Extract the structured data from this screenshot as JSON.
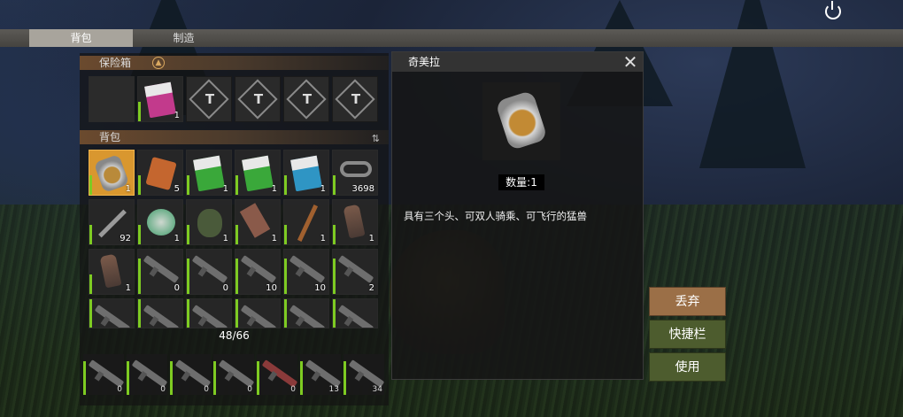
{
  "tabs": {
    "backpack": "背包",
    "craft": "制造"
  },
  "safe_box": {
    "title": "保险箱",
    "slots": [
      {
        "kind": "empty"
      },
      {
        "kind": "item",
        "icon": "pink-recipe-book-icon",
        "color": "#c23a8c",
        "count": "1"
      },
      {
        "kind": "locked",
        "icon": "lock-icon",
        "glyph": "T"
      },
      {
        "kind": "locked",
        "icon": "lock-icon",
        "glyph": "T"
      },
      {
        "kind": "locked",
        "icon": "lock-icon",
        "glyph": "T"
      },
      {
        "kind": "locked",
        "icon": "lock-icon",
        "glyph": "T"
      }
    ]
  },
  "backpack": {
    "title": "背包",
    "sort_icon": "sort-icon",
    "capacity": "48/66",
    "slots": [
      {
        "icon": "dog-tag-icon",
        "count": "1",
        "selected": true
      },
      {
        "icon": "orange-crate-icon",
        "count": "5"
      },
      {
        "icon": "green-recipe-book-icon",
        "count": "1",
        "color": "#3aa83a"
      },
      {
        "icon": "green-recipe-book-icon",
        "count": "1",
        "color": "#3aa83a"
      },
      {
        "icon": "blue-recipe-book-icon",
        "count": "1",
        "color": "#2f95c4"
      },
      {
        "icon": "gun-parts-icon",
        "count": "3698"
      },
      {
        "icon": "syringe-icon",
        "count": "92"
      },
      {
        "icon": "canned-food-icon",
        "count": "1"
      },
      {
        "icon": "grenade-icon",
        "count": "1"
      },
      {
        "icon": "cleaver-icon",
        "count": "1"
      },
      {
        "icon": "wooden-staff-icon",
        "count": "1"
      },
      {
        "icon": "leather-glove-icon",
        "count": "1"
      },
      {
        "icon": "leather-glove-icon",
        "count": "1"
      },
      {
        "icon": "rifle-icon",
        "count": "0"
      },
      {
        "icon": "rifle-icon",
        "count": "0"
      },
      {
        "icon": "rifle-icon",
        "count": "10"
      },
      {
        "icon": "rifle-icon",
        "count": "10"
      },
      {
        "icon": "rifle-icon",
        "count": "2"
      },
      {
        "icon": "rifle-icon",
        "count": ""
      },
      {
        "icon": "rifle-icon",
        "count": ""
      },
      {
        "icon": "rifle-icon",
        "count": ""
      },
      {
        "icon": "rifle-icon",
        "count": ""
      },
      {
        "icon": "rifle-icon",
        "count": ""
      },
      {
        "icon": "rifle-icon",
        "count": ""
      }
    ]
  },
  "hotbar": [
    {
      "icon": "rifle-icon",
      "count": "0"
    },
    {
      "icon": "rifle-icon",
      "count": "0"
    },
    {
      "icon": "rifle-icon",
      "count": "0"
    },
    {
      "icon": "rifle-icon",
      "count": "0"
    },
    {
      "icon": "red-rifle-icon",
      "count": "0"
    },
    {
      "icon": "rifle-icon",
      "count": "13"
    },
    {
      "icon": "rifle-icon",
      "count": "34"
    }
  ],
  "detail": {
    "title": "奇美拉",
    "close_icon": "close-icon",
    "item_icon": "dog-tag-icon",
    "quantity": "数量:1",
    "description": "具有三个头、可双人骑乘、可飞行的猛兽"
  },
  "actions": {
    "drop": "丢弃",
    "hotbar": "快捷栏",
    "use": "使用"
  },
  "colors": {
    "selected": "#d9972f",
    "durability": "#7ecb22",
    "drop_button": "#9b6f47",
    "action_button": "#4d5c2e"
  }
}
